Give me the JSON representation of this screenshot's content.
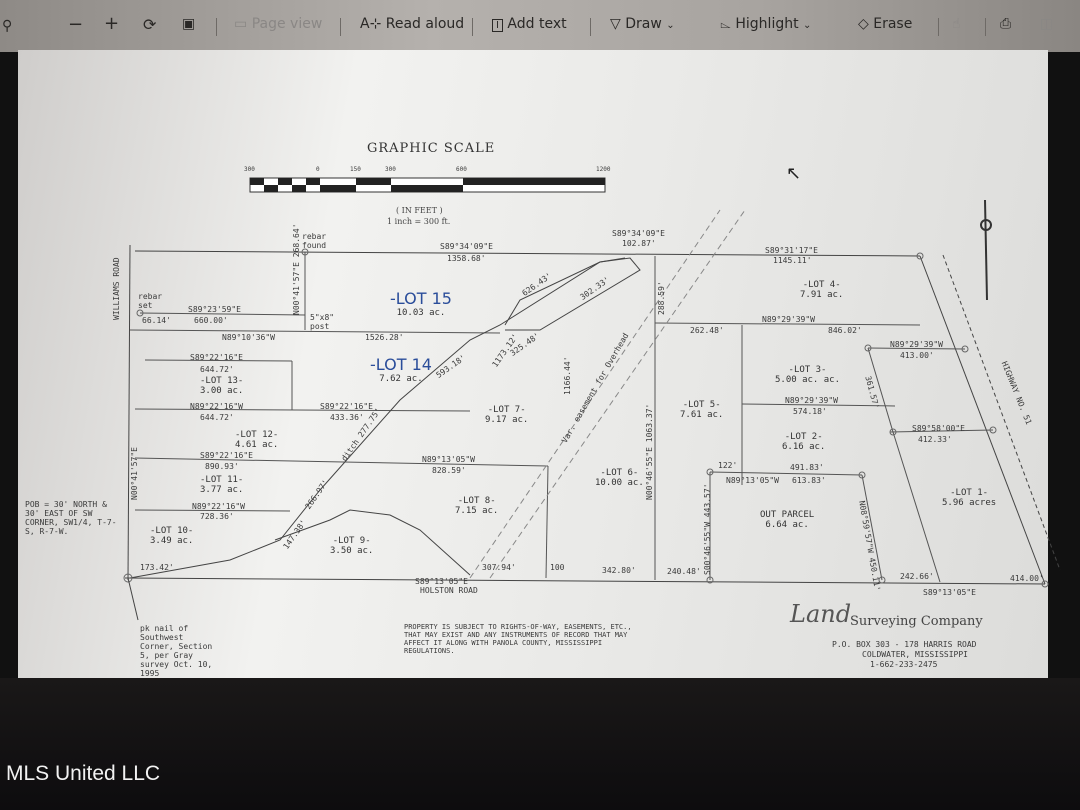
{
  "toolbar": {
    "items": [
      {
        "label": "Page view",
        "icon": "page-view-icon",
        "enabled": false
      },
      {
        "label": "Read aloud",
        "icon": "read-aloud-icon"
      },
      {
        "label": "Add text",
        "icon": "add-text-icon"
      },
      {
        "label": "Draw",
        "icon": "draw-pen-icon"
      },
      {
        "label": "Highlight",
        "icon": "highlighter-icon"
      },
      {
        "label": "Erase",
        "icon": "eraser-icon"
      }
    ],
    "icons": [
      "search-icon",
      "zoom-out-icon",
      "zoom-in-icon",
      "rotate-icon",
      "fit-page-icon",
      "touch-icon",
      "print-icon",
      "save-icon"
    ]
  },
  "scale": {
    "title": "GRAPHIC SCALE",
    "ticks": [
      "300",
      "0",
      "150",
      "300",
      "600",
      "1200"
    ],
    "units": "( IN FEET )",
    "ratio": "1 inch = 300 ft."
  },
  "labels": {
    "rebar_found": "rebar found",
    "rebar_set": "rebar set",
    "post": "5\"x8\" post",
    "top1_bearing": "S89°34'09\"E",
    "top1_dist": "1358.68'",
    "top2_bearing": "S89°34'09\"E",
    "top2_dist": "102.87'",
    "top3_bearing": "S89°31'17\"E",
    "top3_dist": "1145.11'",
    "l15_b": "S89°23'59\"E",
    "l15_d": "660.00'",
    "l15_small": "66.14'",
    "v1": "N00°41'57\"E 268.64'",
    "l14_b": "N89°10'36\"W",
    "l14_d": "1526.28'",
    "d626": "626.43'",
    "d302": "302.33'",
    "d325": "325.48'",
    "d593": "593.18'",
    "d1173": "1173.12'",
    "l13_tb": "S89°22'16\"E",
    "l13_td": "644.72'",
    "l13_bb": "N89°22'16\"W",
    "l13_bd": "644.72'",
    "l12_b": "S89°22'16\"E",
    "l12_d": "433.36'",
    "l11_tb": "S89°22'16\"E",
    "l11_td": "890.93'",
    "l11_bb": "N89°22'16\"W",
    "l11_bd": "728.36'",
    "l8_b": "N89°13'05\"W",
    "l8_d": "828.59'",
    "ditch": "ditch 277.75'",
    "d266": "266.97'",
    "d147": "147.38'",
    "road_w": "WILLIAMS ROAD",
    "road_s": "HOLSTON ROAD",
    "road_e": "HIGHWAY NO. 51",
    "v_west": "N00°41'57\"E",
    "pob": "POB = 30' NORTH & 30' EAST OF SW CORNER, SW1/4, T-7-S, R-7-W.",
    "bottom_b": "S89°13'05\"E",
    "bottom_b2": "S89°13'05\"E",
    "d342": "342.80'",
    "d240": "240.48'",
    "d242": "242.66'",
    "d414": "414.00'",
    "d173": "173.42'",
    "d307": "307.94'",
    "d100": "100",
    "v1166": "1166.44'",
    "v1063": "N00°46'55\"E 1063.37'",
    "v288": "288.59'",
    "l4_b": "N89°29'39\"W",
    "l4_d1": "262.48'",
    "l4_d2": "846.02'",
    "l3_b": "N89°29'39\"W",
    "l3_d": "413.00'",
    "l2_b": "N89°29'39\"W",
    "l2_d": "574.18'",
    "l1_b": "S89°58'00\"E",
    "l1_d": "412.33'",
    "op_b": "N89°13'05\"W",
    "op_d": "613.83'",
    "op_d2": "491.83'",
    "d122": "122'",
    "v443": "S00°46'55\"W 443.57'",
    "v450": "N08°59'57\"W 450.11'",
    "v361": "361.57'",
    "easement": "Var. easement for Overhead",
    "pk_nail": "pk nail of Southwest Corner, Section 5, per Gray survey Oct. 10, 1995",
    "notice": "PROPERTY IS SUBJECT TO RIGHTS-OF-WAY, EASEMENTS, ETC., THAT MAY EXIST AND ANY INSTRUMENTS OF RECORD THAT MAY AFFECT IT ALONG WITH PANOLA COUNTY, MISSISSIPPI REGULATIONS.",
    "company_script": "Land",
    "company": "Surveying Company",
    "address1": "P.O. BOX 303 - 178 HARRIS ROAD",
    "address2": "COLDWATER, MISSISSIPPI",
    "phone": "1-662-233-2475"
  },
  "lots": [
    {
      "name": "-LOT 15",
      "area": "10.03 ac.",
      "handwritten": true
    },
    {
      "name": "-LOT 14",
      "area": "7.62 ac.",
      "handwritten": true
    },
    {
      "name": "-LOT 13-",
      "area": "3.00 ac."
    },
    {
      "name": "-LOT 12-",
      "area": "4.61 ac."
    },
    {
      "name": "-LOT 11-",
      "area": "3.77 ac."
    },
    {
      "name": "-LOT 10-",
      "area": "3.49 ac."
    },
    {
      "name": "-LOT 9-",
      "area": "3.50 ac."
    },
    {
      "name": "-LOT 8-",
      "area": "7.15 ac."
    },
    {
      "name": "-LOT 7-",
      "area": "9.17 ac."
    },
    {
      "name": "-LOT 6-",
      "area": "10.00 ac."
    },
    {
      "name": "-LOT 5-",
      "area": "7.61 ac."
    },
    {
      "name": "-LOT 4-",
      "area": "7.91 ac."
    },
    {
      "name": "-LOT 3-",
      "area": "5.00 ac. ac."
    },
    {
      "name": "-LOT 2-",
      "area": "6.16 ac."
    },
    {
      "name": "-LOT 1-",
      "area": "5.96 acres"
    },
    {
      "name": "OUT PARCEL",
      "area": "6.64 ac."
    }
  ],
  "watermark": "MLS United LLC"
}
